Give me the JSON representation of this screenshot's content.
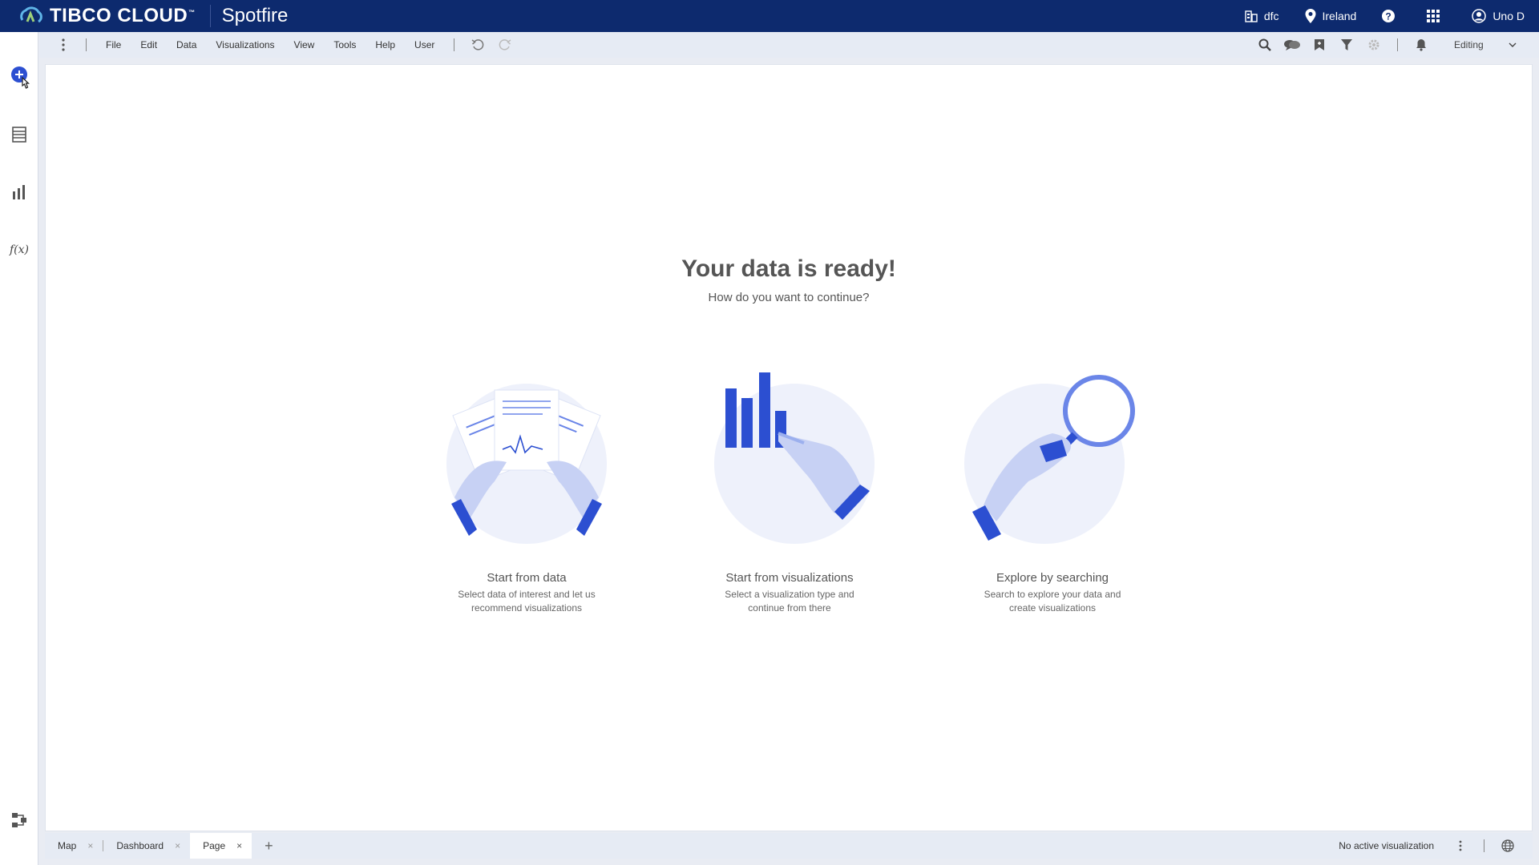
{
  "topbar": {
    "brand": "TIBCO CLOUD",
    "trademark": "™",
    "app_title": "Spotfire",
    "org": "dfc",
    "region": "Ireland",
    "user": "Uno D",
    "colors": {
      "bar": "#0d2a6e"
    }
  },
  "menubar": {
    "items": [
      "File",
      "Edit",
      "Data",
      "Visualizations",
      "View",
      "Tools",
      "Help",
      "User"
    ],
    "mode": "Editing"
  },
  "leftrail": {
    "icons": [
      "add-circle-icon",
      "data-table-icon",
      "bar-chart-icon",
      "function-icon",
      "data-canvas-icon"
    ],
    "function_glyph": "f(x)"
  },
  "main": {
    "title": "Your data is ready!",
    "subtitle": "How do you want to continue?",
    "options": [
      {
        "title": "Start from data",
        "desc1": "Select data of interest and let us",
        "desc2": "recommend visualizations"
      },
      {
        "title": "Start from visualizations",
        "desc1": "Select a visualization type and",
        "desc2": "continue from there"
      },
      {
        "title": "Explore by searching",
        "desc1": "Search to explore your data and",
        "desc2": "create visualizations"
      }
    ],
    "accent": "#2c4fd1"
  },
  "tabs": {
    "pages": [
      "Map",
      "Dashboard",
      "Page"
    ],
    "active": "Page",
    "close_glyph": "×",
    "add_glyph": "+",
    "status": "No active visualization"
  }
}
